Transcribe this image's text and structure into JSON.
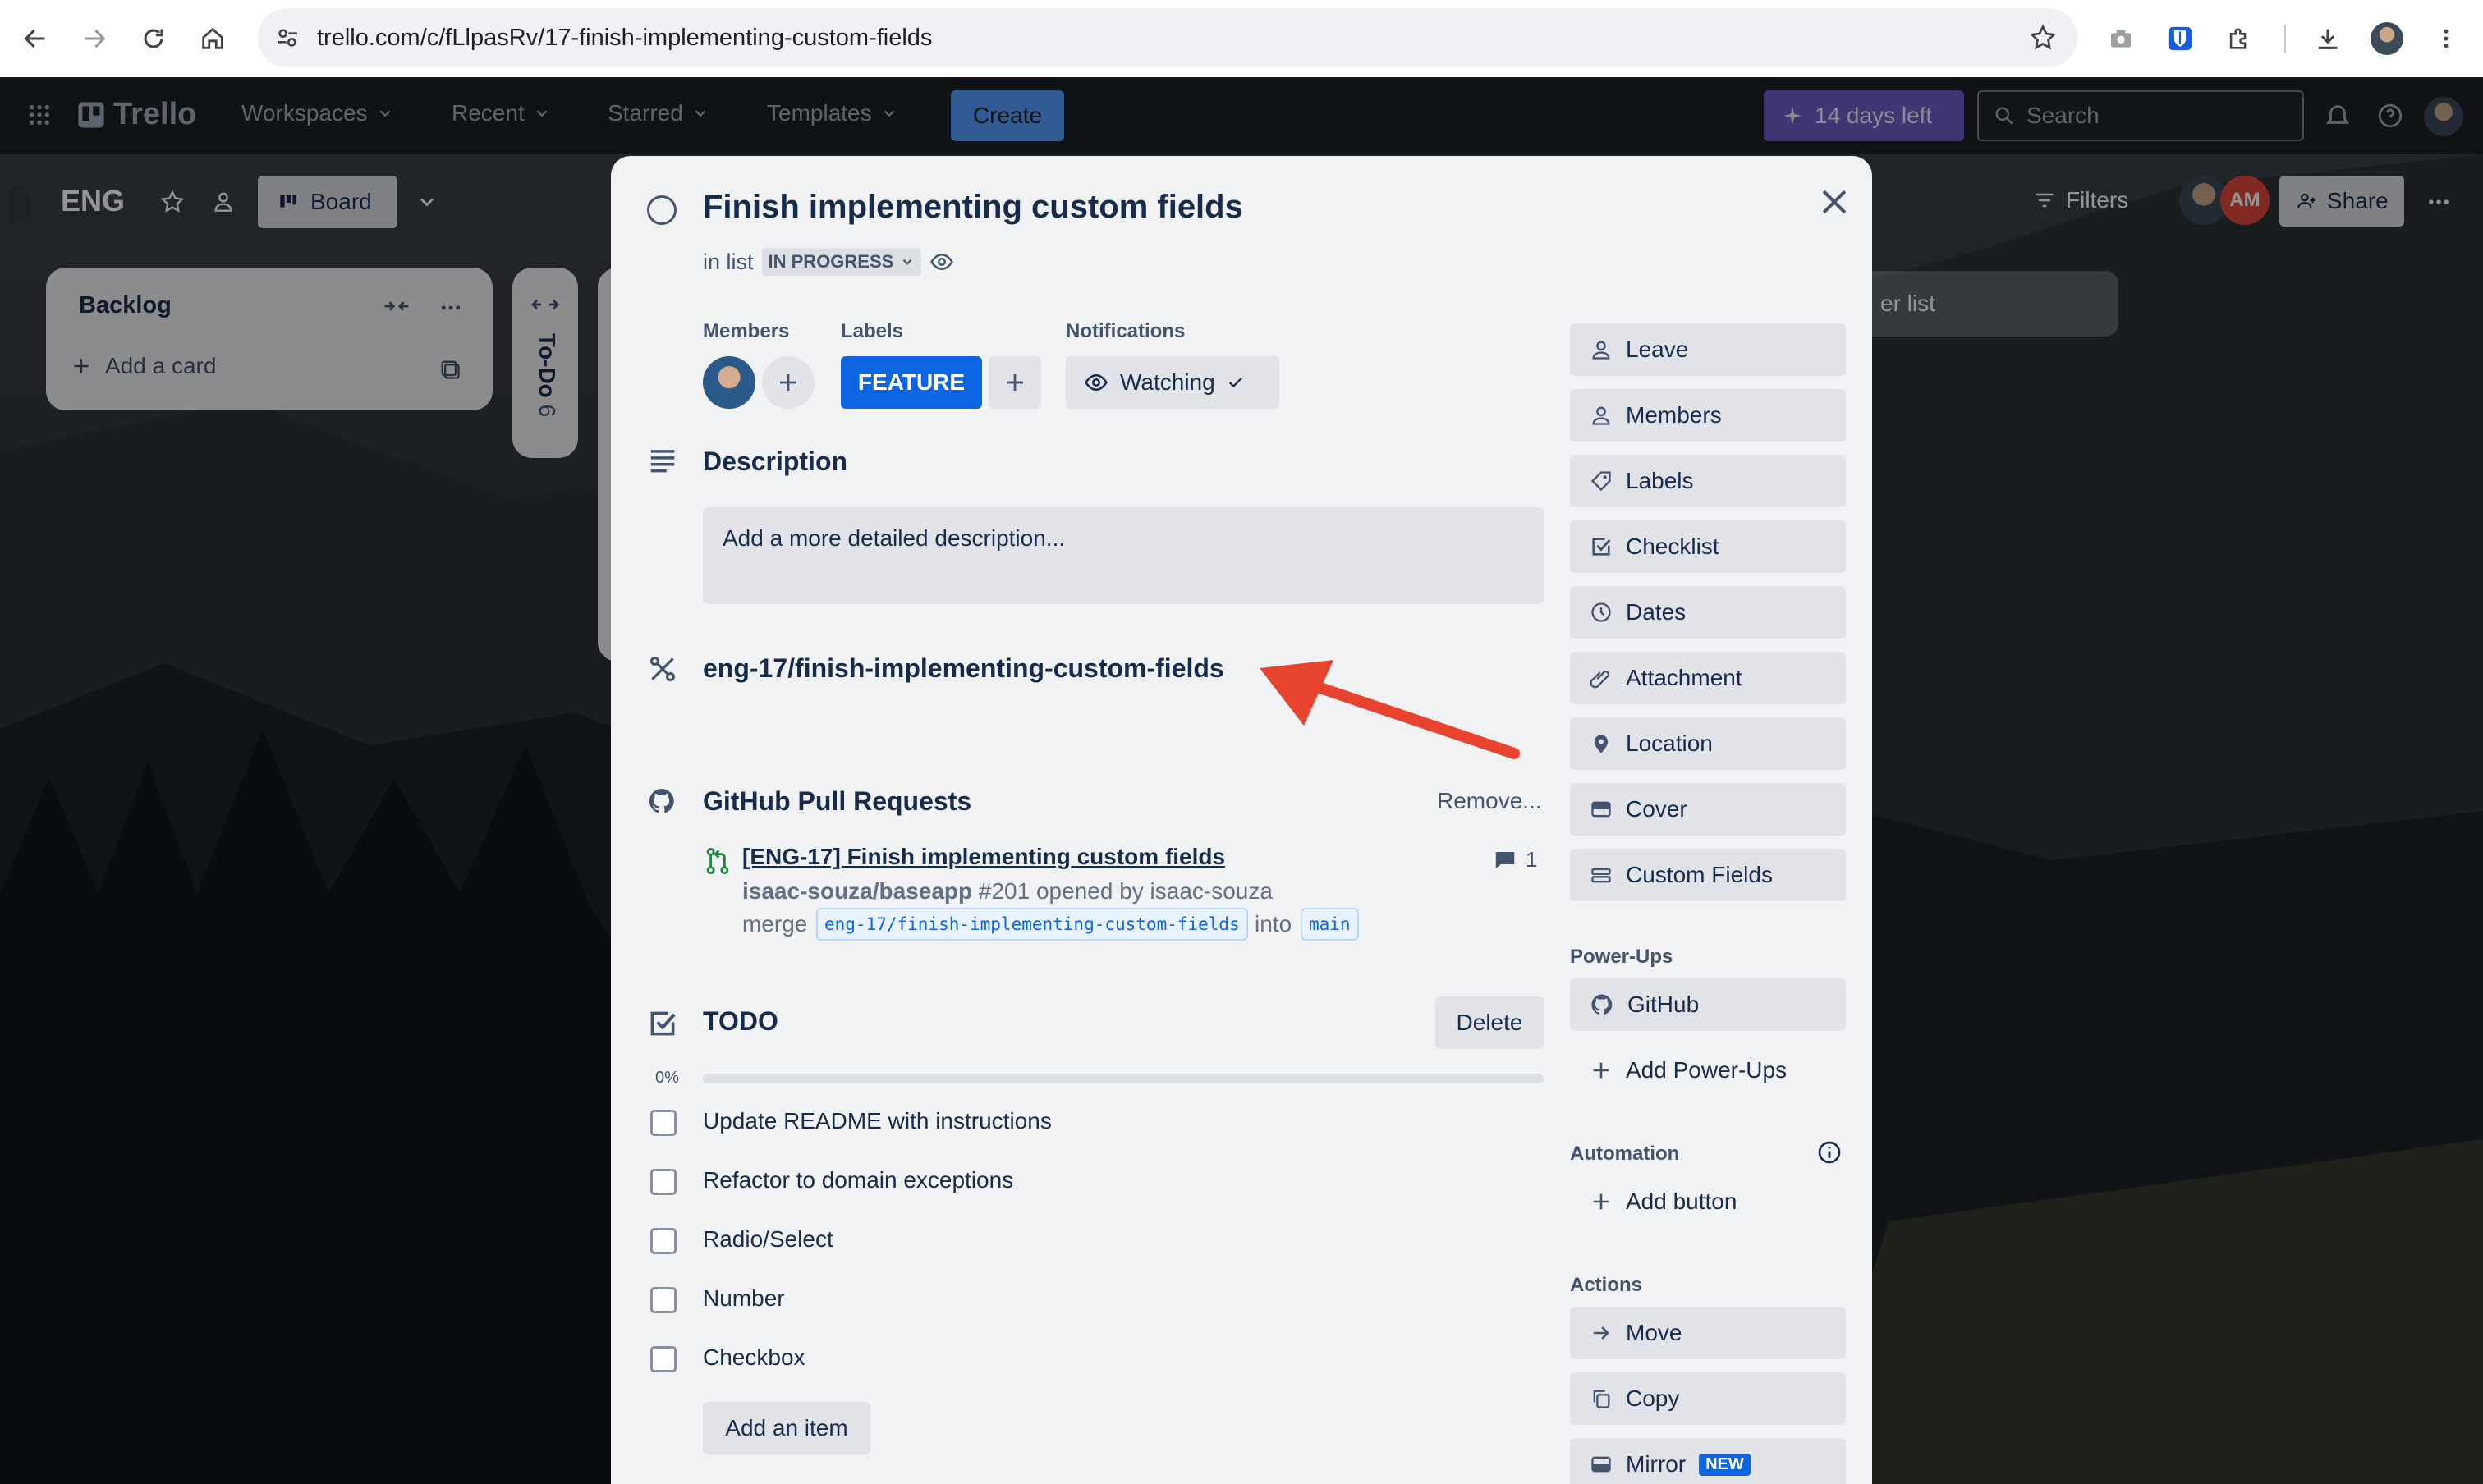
{
  "browser": {
    "url": "trello.com/c/fLlpasRv/17-finish-implementing-custom-fields"
  },
  "trello_header": {
    "logo": "Trello",
    "nav": [
      "Workspaces",
      "Recent",
      "Starred",
      "Templates"
    ],
    "create_label": "Create",
    "trial_label": "14 days left",
    "search_placeholder": "Search"
  },
  "board": {
    "name": "ENG",
    "view_label": "Board",
    "filters_label": "Filters",
    "share_label": "Share",
    "member_initials": "AM",
    "add_list_partial": "er list",
    "lists": [
      {
        "title": "Backlog",
        "add_card_label": "Add a card"
      },
      {
        "title": "To-Do",
        "count": "6"
      }
    ]
  },
  "card": {
    "title": "Finish implementing custom fields",
    "in_list_prefix": "in list",
    "list_name": "IN PROGRESS",
    "members_heading": "Members",
    "labels_heading": "Labels",
    "notifications_heading": "Notifications",
    "label_feature": "FEATURE",
    "watching_label": "Watching",
    "description_heading": "Description",
    "description_placeholder": "Add a more detailed description...",
    "branch_name": "eng-17/finish-implementing-custom-fields",
    "github": {
      "heading": "GitHub Pull Requests",
      "remove_label": "Remove...",
      "pr_title": "[ENG-17] Finish implementing custom fields",
      "repo": "isaac-souza/baseapp",
      "opened_text": "#201 opened by isaac-souza",
      "merge_word": "merge",
      "head_branch": "eng-17/finish-implementing-custom-fields",
      "into_word": "into",
      "base_branch": "main",
      "comment_count": "1"
    },
    "checklist": {
      "title": "TODO",
      "delete_label": "Delete",
      "progress_label": "0%",
      "progress": 0,
      "items": [
        "Update README with instructions",
        "Refactor to domain exceptions",
        "Radio/Select",
        "Number",
        "Checkbox"
      ],
      "add_item_label": "Add an item"
    }
  },
  "sidebar": {
    "actions_top": [
      "Leave",
      "Members",
      "Labels",
      "Checklist",
      "Dates",
      "Attachment",
      "Location",
      "Cover",
      "Custom Fields"
    ],
    "powerups_heading": "Power-Ups",
    "powerup_github": "GitHub",
    "add_powerups": "Add Power-Ups",
    "automation_heading": "Automation",
    "add_button": "Add button",
    "actions_heading": "Actions",
    "actions": [
      "Move",
      "Copy",
      "Mirror"
    ],
    "new_badge": "NEW"
  },
  "colors": {
    "accent_blue": "#0c66e4",
    "annotation_arrow": "#e8432e",
    "trial_purple": "#3b2a6e"
  }
}
